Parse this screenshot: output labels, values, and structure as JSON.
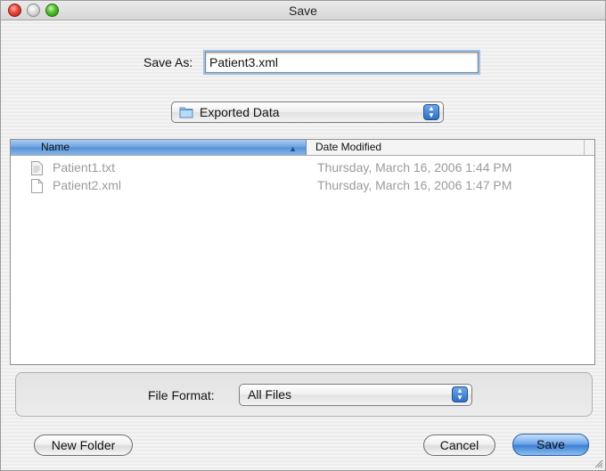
{
  "window": {
    "title": "Save"
  },
  "save_as": {
    "label": "Save As:",
    "value": "Patient3.xml"
  },
  "location": {
    "label": "Exported Data"
  },
  "file_list": {
    "columns": {
      "name": "Name",
      "date": "Date Modified"
    },
    "rows": [
      {
        "name": "Patient1.txt",
        "date": "Thursday, March 16, 2006 1:44 PM",
        "icon": "text-file-icon"
      },
      {
        "name": "Patient2.xml",
        "date": "Thursday, March 16, 2006 1:47 PM",
        "icon": "blank-file-icon"
      }
    ]
  },
  "file_format": {
    "label": "File Format:",
    "value": "All Files"
  },
  "buttons": {
    "new_folder": "New Folder",
    "cancel": "Cancel",
    "save": "Save"
  },
  "colors": {
    "accent": "#3f7fd4",
    "header_selected": "#6aa2e0",
    "disabled_text": "#9b9b9b"
  }
}
